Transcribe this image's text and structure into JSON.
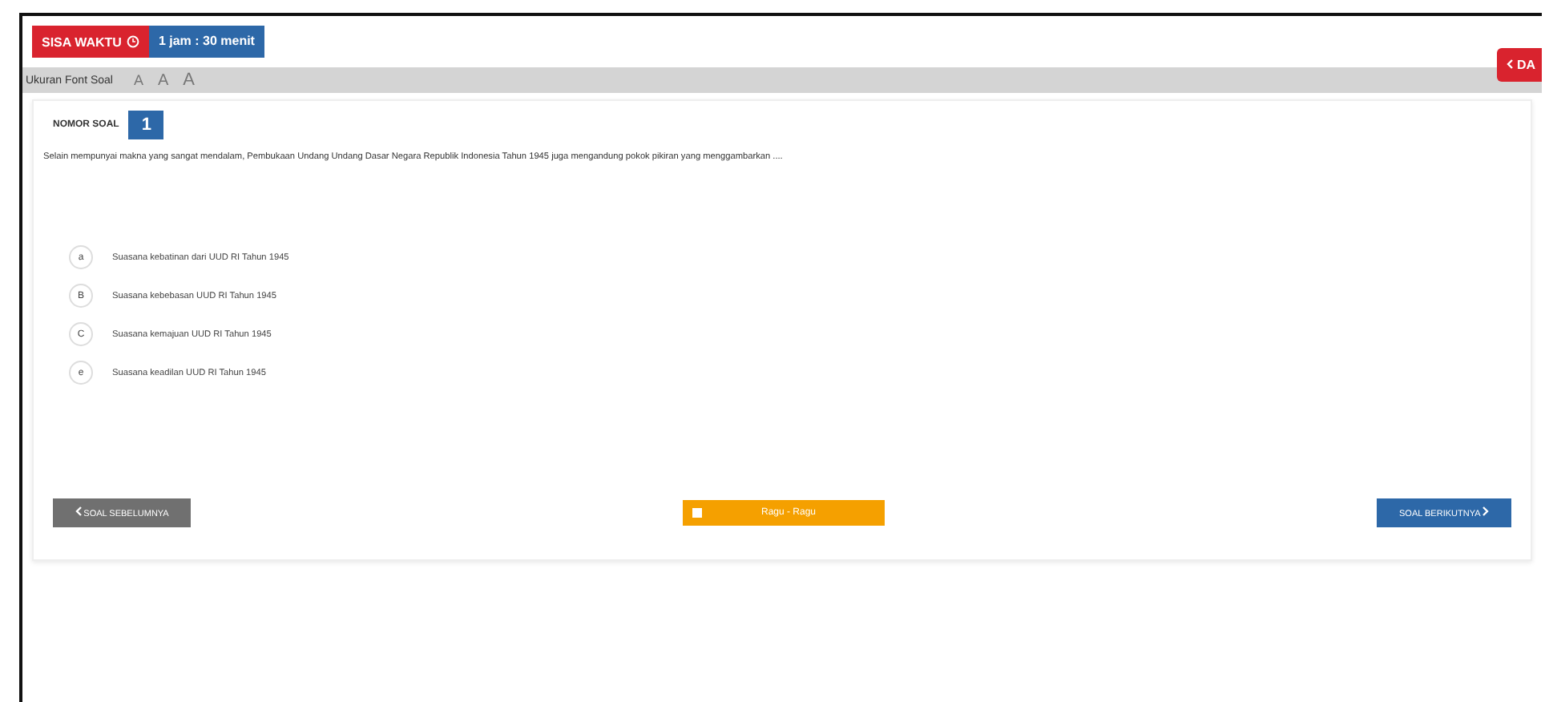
{
  "timer": {
    "label": "SISA WAKTU",
    "value": "1 jam : 30 menit"
  },
  "font_bar": {
    "label": "Ukuran Font Soal",
    "sizes": [
      "A",
      "A",
      "A"
    ]
  },
  "list_button": {
    "label": "DA"
  },
  "question": {
    "number_label": "NOMOR SOAL",
    "number": "1",
    "text": "Selain mempunyai makna yang sangat mendalam, Pembukaan Undang Undang Dasar Negara Republik Indonesia Tahun 1945 juga mengandung pokok pikiran yang menggambarkan ...."
  },
  "options": [
    {
      "letter": "a",
      "text": "Suasana kebatinan dari UUD RI Tahun 1945"
    },
    {
      "letter": "B",
      "text": "Suasana kebebasan UUD RI Tahun 1945"
    },
    {
      "letter": "C",
      "text": "Suasana kemajuan UUD RI Tahun 1945"
    },
    {
      "letter": "e",
      "text": "Suasana keadilan UUD RI Tahun 1945"
    }
  ],
  "buttons": {
    "prev": "SOAL SEBELUMNYA",
    "doubt": "Ragu - Ragu",
    "doubt_checked": false,
    "next": "SOAL BERIKUTNYA"
  }
}
